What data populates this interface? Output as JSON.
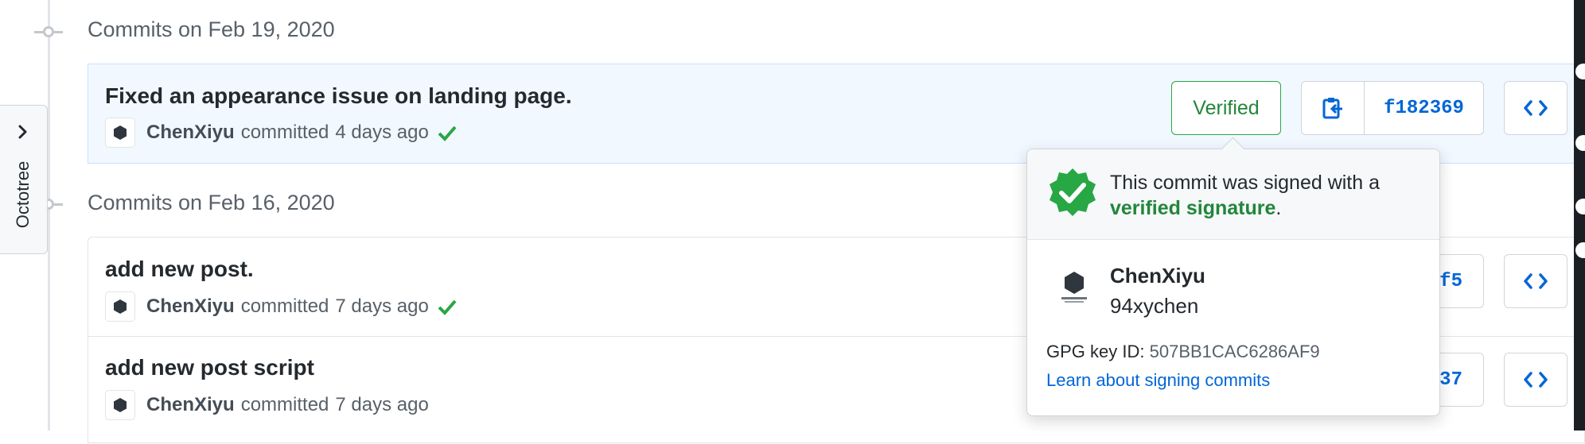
{
  "sidebar": {
    "octotree_label": "Octotree"
  },
  "groups": [
    {
      "title": "Commits on Feb 19, 2020",
      "commits": [
        {
          "title": "Fixed an appearance issue on landing page.",
          "author": "ChenXiyu",
          "action": "committed",
          "time": "4 days ago",
          "verified_label": "Verified",
          "sha": "f182369"
        }
      ]
    },
    {
      "title": "Commits on Feb 16, 2020",
      "commits": [
        {
          "title": "add new post.",
          "author": "ChenXiyu",
          "action": "committed",
          "time": "7 days ago",
          "sha_fragment": "lf5"
        },
        {
          "title": "add new post script",
          "author": "ChenXiyu",
          "action": "committed",
          "time": "7 days ago",
          "sha_fragment": "l37"
        }
      ]
    }
  ],
  "popover": {
    "message_prefix": "This commit was signed with a",
    "message_link": "verified signature",
    "message_suffix": ".",
    "name": "ChenXiyu",
    "login": "94xychen",
    "gpg_label": "GPG key ID:",
    "gpg_key": "507BB1CAC6286AF9",
    "learn_link": "Learn about signing commits"
  },
  "colors": {
    "verified_green": "#28a745",
    "link_blue": "#0366d6",
    "highlight_row": "#f1f8ff"
  },
  "icons": [
    "git-commit-icon",
    "check-icon",
    "clipboard-icon",
    "code-icon",
    "chevron-right-icon",
    "verified-badge-icon"
  ]
}
